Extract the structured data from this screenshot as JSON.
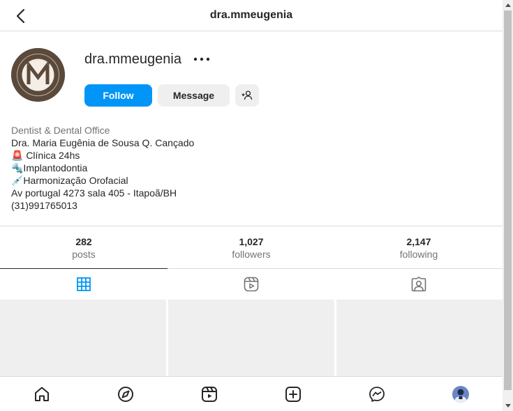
{
  "header": {
    "title": "dra.mmeugenia"
  },
  "profile": {
    "username": "dra.mmeugenia",
    "follow_label": "Follow",
    "message_label": "Message"
  },
  "bio": {
    "category": "Dentist & Dental Office",
    "name": "Dra. Maria Eugênia de Sousa Q. Cançado",
    "lines": [
      "🚨 Clínica 24hs",
      "🔩Implantodontia",
      "💉Harmonização Orofacial",
      "Av portugal 4273 sala 405 - Itapoã/BH",
      "(31)991765013"
    ]
  },
  "stats": [
    {
      "num": "282",
      "label": "posts"
    },
    {
      "num": "1,027",
      "label": "followers"
    },
    {
      "num": "2,147",
      "label": "following"
    }
  ],
  "tabs": [
    {
      "icon": "grid-icon",
      "active": true
    },
    {
      "icon": "reels-icon",
      "active": false
    },
    {
      "icon": "tagged-icon",
      "active": false
    }
  ],
  "nav": [
    {
      "icon": "home-icon"
    },
    {
      "icon": "explore-icon"
    },
    {
      "icon": "reels-icon"
    },
    {
      "icon": "new-post-icon"
    },
    {
      "icon": "messenger-icon"
    },
    {
      "icon": "profile-avatar"
    }
  ],
  "colors": {
    "accent": "#0095f6",
    "border": "#dbdbdb",
    "secondary_text": "#737373",
    "avatar_bg": "#5b4a3b"
  }
}
